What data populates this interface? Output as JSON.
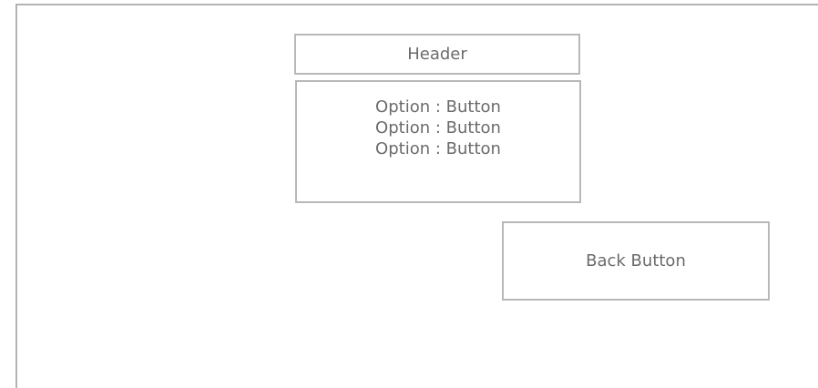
{
  "header": {
    "title": "Header"
  },
  "options": [
    {
      "label": "Option",
      "separator": ":",
      "button": "Button"
    },
    {
      "label": "Option",
      "separator": ":",
      "button": "Button"
    },
    {
      "label": "Option",
      "separator": ":",
      "button": "Button"
    }
  ],
  "back_button": {
    "label": "Back Button"
  },
  "colors": {
    "border": "#b8b8b8",
    "text": "#6b6b6b",
    "background": "#ffffff"
  }
}
